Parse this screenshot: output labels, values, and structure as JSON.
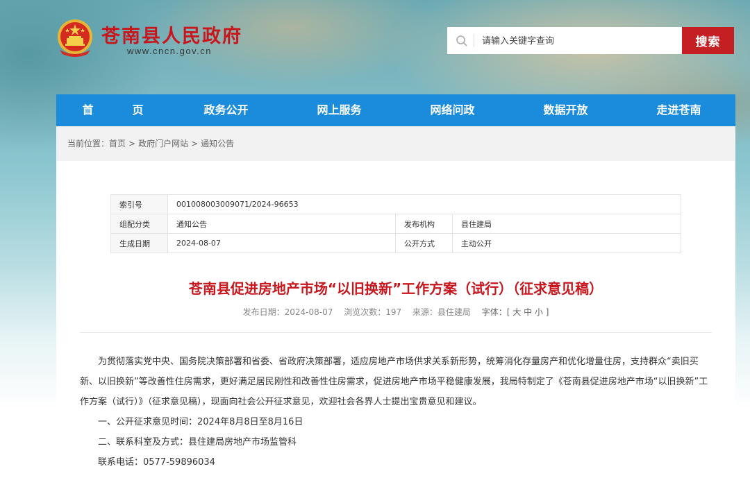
{
  "header": {
    "site_title": "苍南县人民政府",
    "site_url": "www.cncn.gov.cn",
    "search_placeholder": "请输入关键字查询",
    "search_button": "搜索"
  },
  "nav": {
    "items": [
      "首　页",
      "政务公开",
      "网上服务",
      "网络问政",
      "数据开放",
      "走进苍南"
    ]
  },
  "breadcrumb": {
    "prefix": "当前位置：",
    "items": [
      "首页",
      "政府门户网站",
      "通知公告"
    ],
    "separator": ">"
  },
  "info_table": {
    "index_label": "索引号",
    "index_value": "001008003009071/2024-96653",
    "category_label": "组配分类",
    "category_value": "通知公告",
    "publisher_label": "发布机构",
    "publisher_value": "县住建局",
    "date_label": "生成日期",
    "date_value": "2024-08-07",
    "open_label": "公开方式",
    "open_value": "主动公开"
  },
  "article": {
    "title": "苍南县促进房地产市场“以旧换新”工作方案（试行）（征求意见稿）",
    "meta_date": "发布日期：2024-08-07",
    "meta_views": "浏览次数：197",
    "meta_source": "来源：县住建局",
    "meta_font": "字体：[ 大 中 小 ]",
    "para1": "为贯彻落实党中央、国务院决策部署和省委、省政府决策部署，适应房地产市场供求关系新形势，统筹消化存量房产和优化增量住房，支持群众“卖旧买新、以旧换新”等改善性住房需求，更好满足居民刚性和改善性住房需求，促进房地产市场平稳健康发展，我局特制定了《苍南县促进房地产市场“以旧换新”工作方案（试行）》（征求意见稿），现面向社会公开征求意见，欢迎社会各界人士提出宝贵意见和建议。",
    "line1": "一、公开征求意见时间：2024年8月8日至8月16日",
    "line2": "二、联系科室及方式：县住建局房地产市场监管科",
    "line3": "联系电话：0577-59896034"
  },
  "colors": {
    "brand_red": "#c8161d",
    "nav_blue": "#1b8cdc",
    "search_red": "#c41f23"
  }
}
